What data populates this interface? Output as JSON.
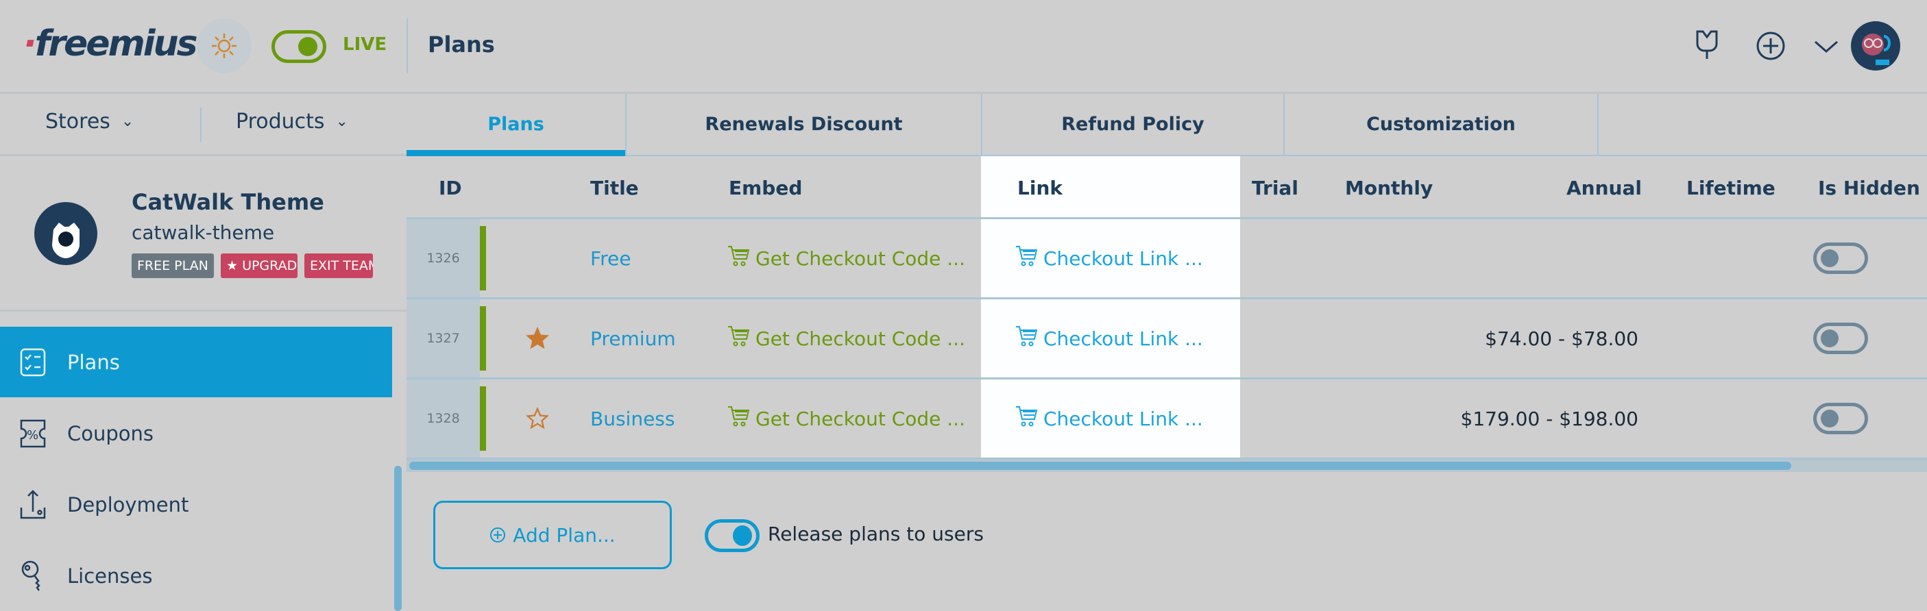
{
  "header": {
    "logo": "freemius",
    "mode_label": "LIVE",
    "page_title": "Plans",
    "icons": [
      "sun-icon",
      "plug-icon",
      "plus-circle-icon",
      "chevron-down-icon"
    ],
    "live_mode_on": true
  },
  "selectors": {
    "stores": "Stores",
    "products": "Products"
  },
  "tabs": [
    {
      "label": "Plans",
      "active": true
    },
    {
      "label": "Renewals Discount"
    },
    {
      "label": "Refund Policy"
    },
    {
      "label": "Customization"
    }
  ],
  "product": {
    "name": "CatWalk Theme",
    "slug": "catwalk-theme",
    "badges": [
      "FREE PLAN",
      "★ UPGRADE",
      "EXIT TEAM"
    ]
  },
  "sidebar": {
    "items": [
      {
        "label": "Plans",
        "icon": "checklist-icon",
        "active": true
      },
      {
        "label": "Coupons",
        "icon": "coupon-icon"
      },
      {
        "label": "Deployment",
        "icon": "upload-icon"
      },
      {
        "label": "Licenses",
        "icon": "key-icon"
      }
    ]
  },
  "table": {
    "columns": [
      "ID",
      "Title",
      "Embed",
      "Link",
      "Trial",
      "Monthly",
      "Annual",
      "Lifetime",
      "Is Hidden"
    ],
    "rows": [
      {
        "id": "1326",
        "star": "none",
        "title": "Free",
        "embed": "Get Checkout Code ...",
        "link": "Checkout Link ...",
        "trial": "",
        "monthly": "",
        "annual": "",
        "lifetime": "",
        "hidden": false
      },
      {
        "id": "1327",
        "star": "filled",
        "title": "Premium",
        "embed": "Get Checkout Code ...",
        "link": "Checkout Link ...",
        "trial": "",
        "monthly": "",
        "annual": "$74.00 - $78.00",
        "lifetime": "",
        "hidden": false
      },
      {
        "id": "1328",
        "star": "outline",
        "title": "Business",
        "embed": "Get Checkout Code ...",
        "link": "Checkout Link ...",
        "trial": "",
        "monthly": "",
        "annual": "$179.00 - $198.00",
        "lifetime": "",
        "hidden": false
      }
    ]
  },
  "footer": {
    "add_plan": "Add Plan...",
    "release_label": "Release plans to users",
    "release_on": true
  },
  "colors": {
    "accent": "#0e9ad0",
    "navy": "#1f3d5a",
    "green": "#6a9a0e",
    "link": "#1aa5e0",
    "star": "#c97a30",
    "badge_red": "#c8435f",
    "badge_gray": "#6b7780"
  }
}
